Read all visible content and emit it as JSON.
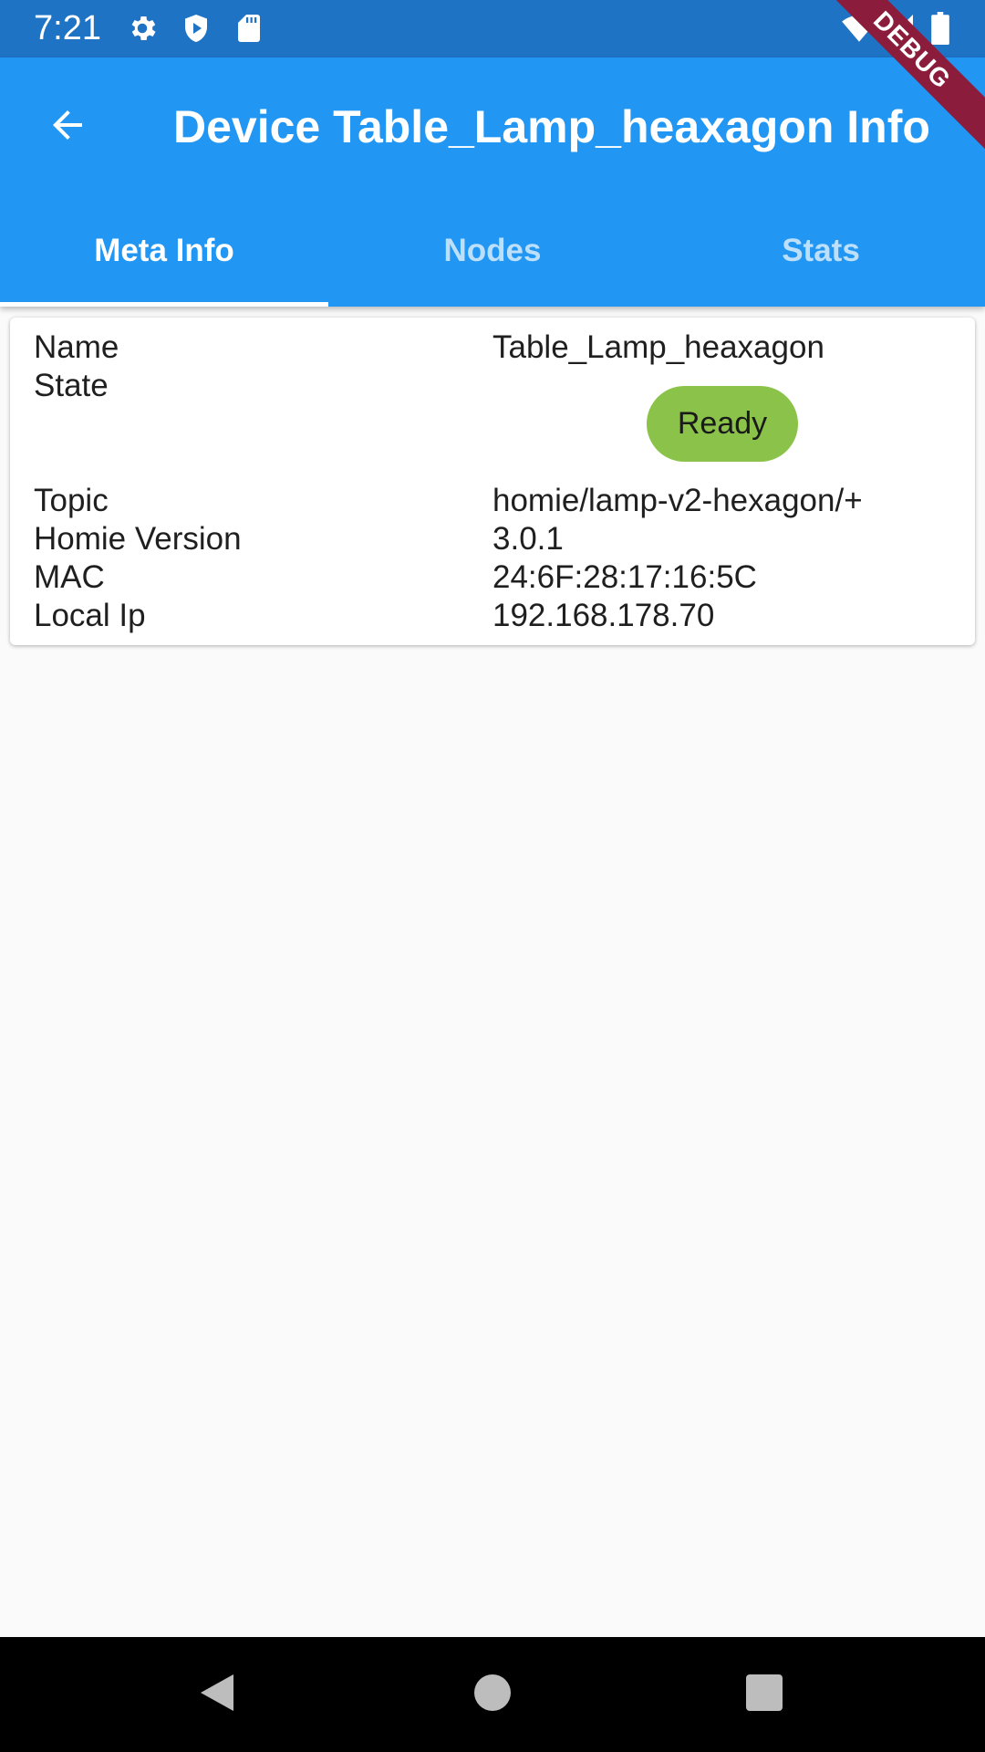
{
  "status_bar": {
    "time": "7:21",
    "icons": [
      "gear-icon",
      "shield-play-icon",
      "sd-card-icon",
      "wifi-icon",
      "signal-icon",
      "battery-icon"
    ]
  },
  "debug_banner": {
    "label": "DEBUG"
  },
  "app_bar": {
    "title": "Device Table_Lamp_heaxagon Info",
    "back_icon": "arrow-back-icon",
    "tabs": [
      {
        "label": "Meta Info",
        "active": true
      },
      {
        "label": "Nodes",
        "active": false
      },
      {
        "label": "Stats",
        "active": false
      }
    ]
  },
  "meta_info": {
    "name": {
      "label": "Name",
      "value": "Table_Lamp_heaxagon"
    },
    "state": {
      "label": "State",
      "value": "Ready",
      "color": "#8bc34a"
    },
    "topic": {
      "label": "Topic",
      "value": "homie/lamp-v2-hexagon/+"
    },
    "homie_version": {
      "label": "Homie Version",
      "value": "3.0.1"
    },
    "mac": {
      "label": "MAC",
      "value": "24:6F:28:17:16:5C"
    },
    "local_ip": {
      "label": "Local Ip",
      "value": "192.168.178.70"
    }
  },
  "nav_bar": {
    "icons": [
      "back-triangle-icon",
      "home-circle-icon",
      "recents-square-icon"
    ]
  },
  "colors": {
    "status_bar": "#1e73c4",
    "app_bar": "#2196f3",
    "background": "#fafafa",
    "chip": "#8bc34a"
  }
}
